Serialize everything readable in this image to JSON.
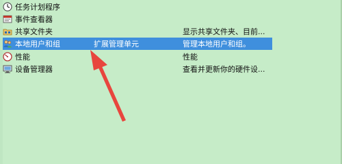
{
  "list": {
    "items": [
      {
        "icon": "clock-icon",
        "name": "任务计划程序",
        "type": "",
        "description": ""
      },
      {
        "icon": "event-viewer-icon",
        "name": "事件查看器",
        "type": "",
        "description": ""
      },
      {
        "icon": "shared-folder-icon",
        "name": "共享文件夹",
        "type": "",
        "description": "显示共享文件夹、目前..."
      },
      {
        "icon": "users-icon",
        "name": "本地用户和组",
        "type": "扩展管理单元",
        "description": "管理本地用户和组。"
      },
      {
        "icon": "performance-icon",
        "name": "性能",
        "type": "",
        "description": "性能"
      },
      {
        "icon": "device-manager-icon",
        "name": "设备管理器",
        "type": "",
        "description": "查看并更新你的硬件设..."
      }
    ],
    "selected_index": 3
  },
  "colors": {
    "background": "#c6ecc8",
    "selection": "#3f8fdd",
    "annotation_arrow": "#e8463e"
  }
}
